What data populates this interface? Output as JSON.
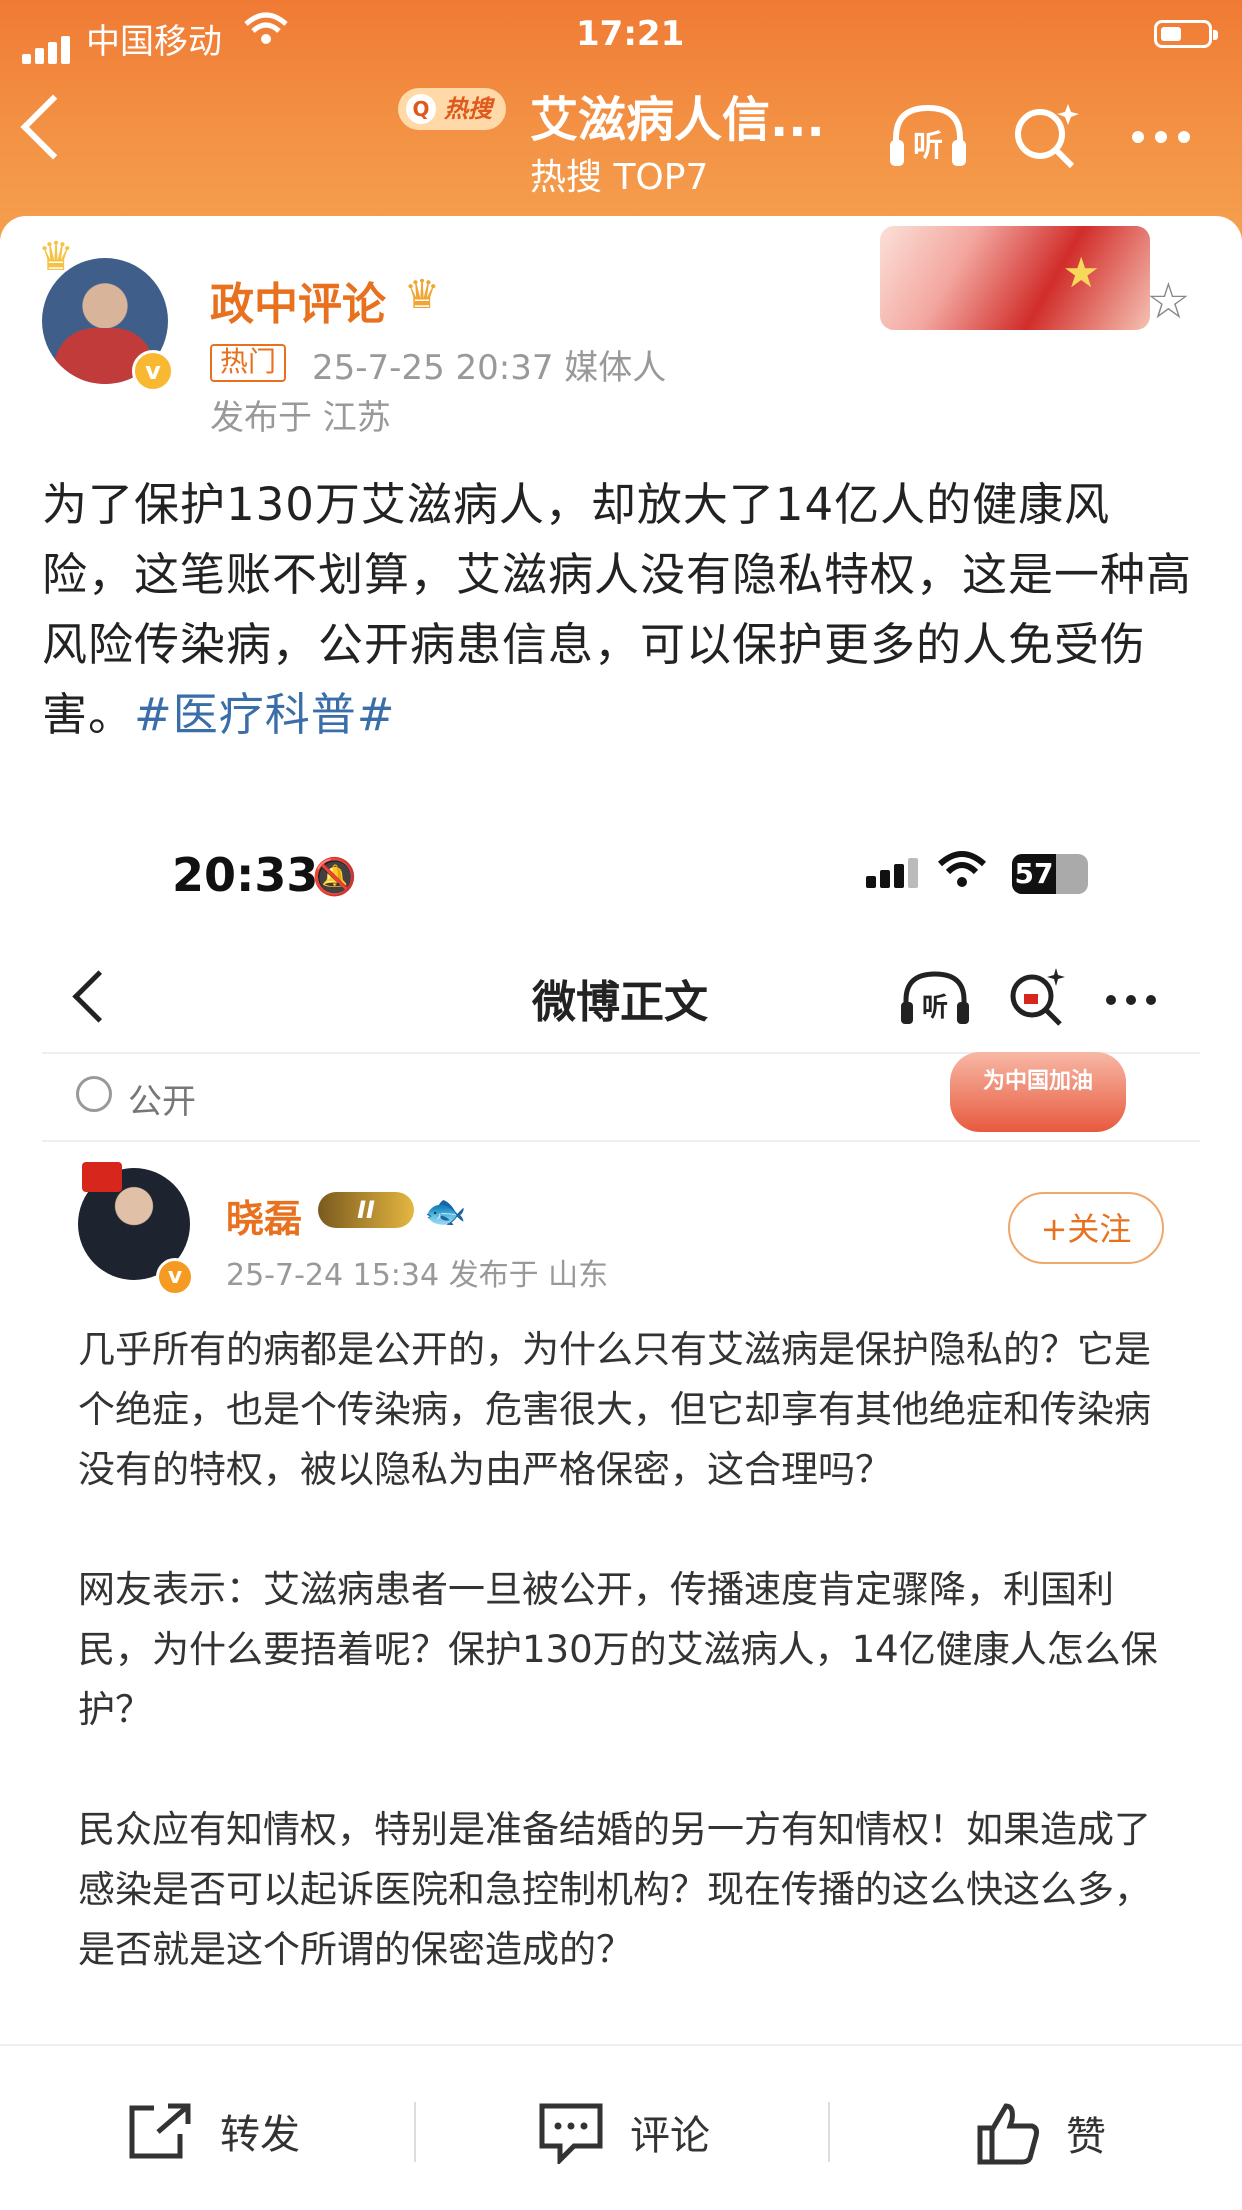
{
  "status_bar": {
    "carrier": "中国移动",
    "time": "17:21"
  },
  "nav": {
    "hot_badge": "热搜",
    "title": "艾滋病人信...",
    "subtitle": "热搜 TOP7",
    "listen_label": "听"
  },
  "post": {
    "author": "政中评论",
    "hot_tag": "热门",
    "meta": "25-7-25 20:37  媒体人",
    "location": "发布于 江苏",
    "text": "为了保护130万艾滋病人，却放大了14亿人的健康风险，这笔账不划算，艾滋病人没有隐私特权，这是一种高风险传染病，公开病患信息，可以保护更多的人免受伤害。",
    "hashtag": "#医疗科普#"
  },
  "screenshot": {
    "time": "20:33",
    "battery": "57",
    "title": "微博正文",
    "listen_label": "听",
    "visibility": "公开",
    "banner_text": "为中国加油",
    "author": "晓磊",
    "level_badge": "II",
    "follow": "+关注",
    "meta": "25-7-24 15:34  发布于 山东",
    "paragraphs": [
      "几乎所有的病都是公开的，为什么只有艾滋病是保护隐私的？它是个绝症，也是个传染病，危害很大，但它却享有其他绝症和传染病没有的特权，被以隐私为由严格保密，这合理吗？",
      "网友表示：艾滋病患者一旦被公开，传播速度肯定骤降，利国利民，为什么要捂着呢？保护130万的艾滋病人，14亿健康人怎么保护？",
      "民众应有知情权，特别是准备结婚的另一方有知情权！如果造成了感染是否可以起诉医院和急控制机构？现在传播的这么快这么多，是否就是这个所谓的保密造成的？"
    ]
  },
  "actions": {
    "repost": "转发",
    "comment": "评论",
    "like": "赞"
  },
  "colors": {
    "header": "#f39244",
    "accent": "#e8711f",
    "link": "#3a6ea8"
  }
}
